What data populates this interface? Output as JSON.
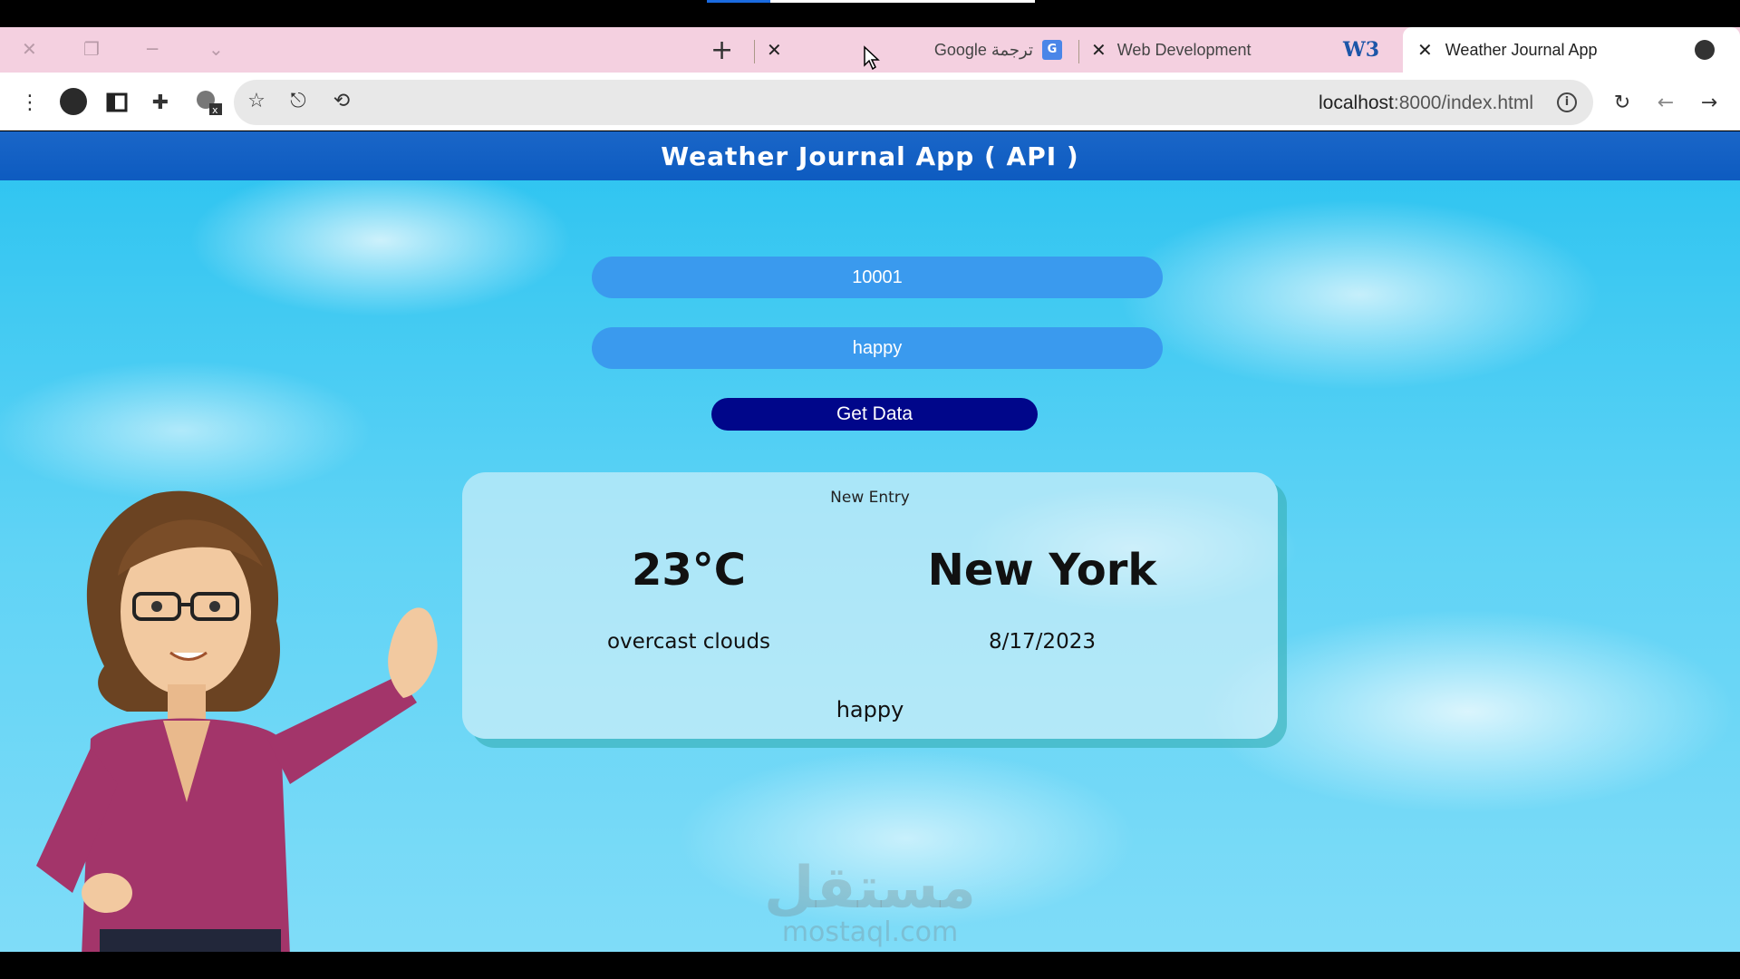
{
  "browser": {
    "tabs": [
      {
        "title": "Google ترجمة",
        "icon": "google-translate-icon"
      },
      {
        "title": "Web Development",
        "icon": "close-icon"
      },
      {
        "title": "Weather Journal App",
        "icon": "w3schools-icon",
        "active": true
      }
    ],
    "w3_icon_text": "W3",
    "gt_icon_text": "G",
    "url_host": "localhost",
    "url_rest": ":8000/index.html"
  },
  "app": {
    "header_title": "Weather Journal App ( API )",
    "zip_value": "10001",
    "feelings_value": "happy",
    "button_label": "Get Data",
    "entry": {
      "title": "New Entry",
      "temperature": "23°C",
      "city": "New York",
      "description": "overcast clouds",
      "date": "8/17/2023",
      "feelings": "happy"
    }
  },
  "watermark": {
    "arabic": "مستقل",
    "latin": "mostaql.com"
  },
  "colors": {
    "header": "#0d5bc0",
    "input": "#3a9aee",
    "button": "#00068a",
    "tabbar": "#f4d0e0"
  }
}
